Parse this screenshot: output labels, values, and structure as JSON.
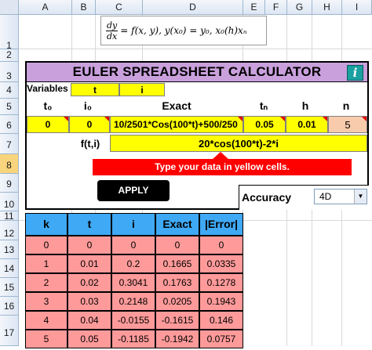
{
  "sheet": {
    "columns": [
      "A",
      "B",
      "C",
      "D",
      "E",
      "F",
      "G",
      "H",
      "I"
    ],
    "rows": [
      "1",
      "2",
      "3",
      "4",
      "5",
      "6",
      "7",
      "8",
      "9",
      "10",
      "11",
      "12",
      "13",
      "14",
      "15",
      "16",
      "17"
    ],
    "selected_row": "8"
  },
  "formula": {
    "dy": "dy",
    "dx": "dx",
    "rest": "= f(x, y),   y(x₀) = y₀,    x₀(h)xₙ"
  },
  "calculator": {
    "title": "EULER SPREADSHEET CALCULATOR",
    "info_icon": "i",
    "variables_label": "Variables",
    "var_t": "t",
    "var_i": "i",
    "headers": {
      "t0": "t₀",
      "i0": "i₀",
      "exact": "Exact",
      "tn": "tₙ",
      "h": "h",
      "n": "n"
    },
    "values": {
      "t0": "0",
      "i0": "0",
      "exact": "10/2501*Cos(100*t)+500/250",
      "tn": "0.05",
      "h": "0.01",
      "n": "5"
    },
    "fti_label": "f(t,i)",
    "fti_value": "20*cos(100*t)-2*i",
    "hint": "Type your data in yellow cells.",
    "apply": "APPLY",
    "accuracy_label": "Accuracy",
    "accuracy_value": "4D"
  },
  "colors": {
    "title": "#c9a0dc",
    "input": "#ffff00",
    "table_header": "#3fa9f5",
    "table_row": "#ff9a9a",
    "hint": "#ff0000"
  },
  "results": {
    "headers": [
      "k",
      "t",
      "i",
      "Exact",
      "|Error|"
    ],
    "rows": [
      [
        "0",
        "0",
        "0",
        "0",
        "0"
      ],
      [
        "1",
        "0.01",
        "0.2",
        "0.1665",
        "0.0335"
      ],
      [
        "2",
        "0.02",
        "0.3041",
        "0.1763",
        "0.1278"
      ],
      [
        "3",
        "0.03",
        "0.2148",
        "0.0205",
        "0.1943"
      ],
      [
        "4",
        "0.04",
        "-0.0155",
        "-0.1615",
        "0.146"
      ],
      [
        "5",
        "0.05",
        "-0.1185",
        "-0.1942",
        "0.0757"
      ]
    ]
  }
}
